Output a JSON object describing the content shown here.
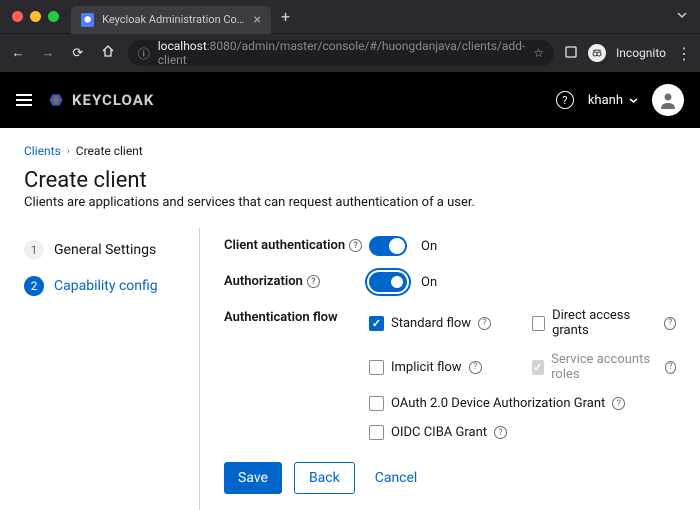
{
  "browser": {
    "tab_title": "Keycloak Administration Conso",
    "url_host": "localhost",
    "url_port": ":8080",
    "url_path": "/admin/master/console/#/huongdanjava/clients/add-client",
    "incognito_label": "Incognito"
  },
  "header": {
    "brand": "KEYCLOAK",
    "username": "khanh"
  },
  "breadcrumb": {
    "root": "Clients",
    "current": "Create client"
  },
  "page": {
    "title": "Create client",
    "description": "Clients are applications and services that can request authentication of a user."
  },
  "steps": [
    {
      "num": "1",
      "label": "General Settings",
      "active": false
    },
    {
      "num": "2",
      "label": "Capability config",
      "active": true
    }
  ],
  "form": {
    "client_auth_label": "Client authentication",
    "client_auth_value": "On",
    "authorization_label": "Authorization",
    "authorization_value": "On",
    "auth_flow_label": "Authentication flow",
    "flows": {
      "standard": "Standard flow",
      "direct": "Direct access grants",
      "implicit": "Implicit flow",
      "service": "Service accounts roles",
      "device": "OAuth 2.0 Device Authorization Grant",
      "ciba": "OIDC CIBA Grant"
    }
  },
  "footer": {
    "save": "Save",
    "back": "Back",
    "cancel": "Cancel"
  }
}
